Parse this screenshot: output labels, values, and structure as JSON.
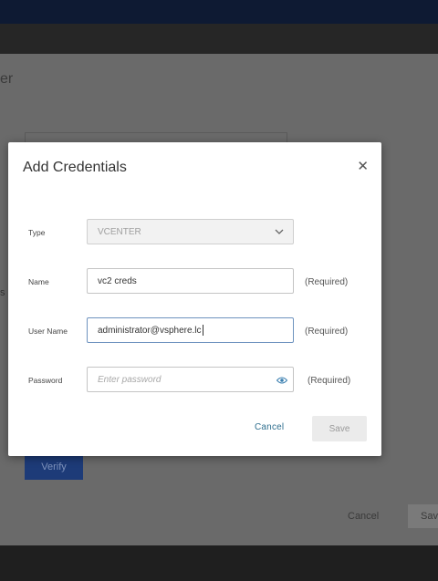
{
  "background": {
    "title_fragment": "er",
    "side_fragment": "s",
    "verify_label": "Verify",
    "cancel_label": "Cancel",
    "save_label": "Sav"
  },
  "modal": {
    "title": "Add Credentials",
    "close_icon": "close-icon",
    "fields": {
      "type": {
        "label": "Type",
        "value": "VCENTER"
      },
      "name": {
        "label": "Name",
        "value": "vc2 creds",
        "note": "(Required)"
      },
      "username": {
        "label": "User Name",
        "value": "administrator@vsphere.lc",
        "note": "(Required)"
      },
      "password": {
        "label": "Password",
        "placeholder": "Enter password",
        "value": "",
        "note": "(Required)"
      }
    },
    "buttons": {
      "cancel": "Cancel",
      "save": "Save"
    }
  },
  "colors": {
    "topbar": "#0e1a33",
    "accent_link": "#2f6f8f",
    "verify_button": "#1d3b78"
  }
}
